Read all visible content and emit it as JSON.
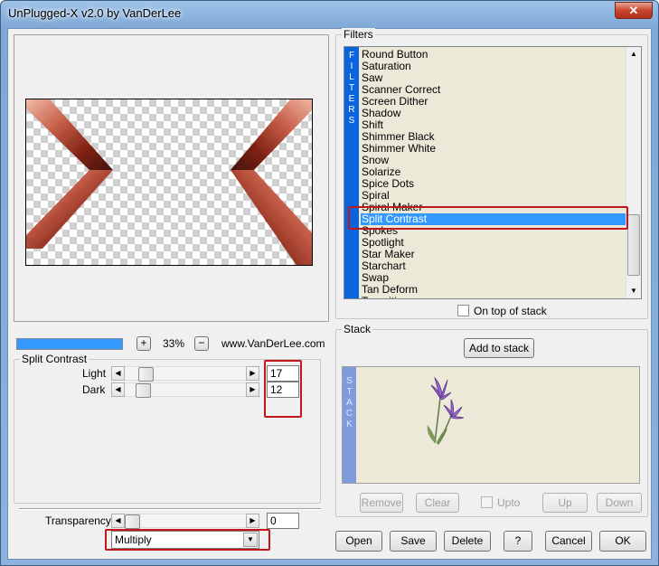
{
  "window": {
    "title": "UnPlugged-X v2.0 by VanDerLee",
    "close_glyph": "✕"
  },
  "preview": {
    "zoom_plus": "+",
    "zoom_value": "33%",
    "zoom_minus": "−",
    "website": "www.VanDerLee.com",
    "progress": 1.0
  },
  "filter_settings": {
    "group_label": "Split Contrast",
    "params": [
      {
        "label": "Light",
        "value": "17",
        "position": 0.13
      },
      {
        "label": "Dark",
        "value": "12",
        "position": 0.1
      }
    ],
    "transparency": {
      "label": "Transparency",
      "value": "0",
      "position": 0.0
    },
    "blend_mode": "Multiply"
  },
  "filters": {
    "group_label": "Filters",
    "strip_letters": [
      "F",
      "I",
      "L",
      "T",
      "E",
      "R",
      "S"
    ],
    "items": [
      "Round Button",
      "Saturation",
      "Saw",
      "Scanner Correct",
      "Screen Dither",
      "Shadow",
      "Shift",
      "Shimmer Black",
      "Shimmer White",
      "Snow",
      "Solarize",
      "Spice Dots",
      "Spiral",
      "Spiral Maker",
      "Split Contrast",
      "Spokes",
      "Spotlight",
      "Star Maker",
      "Starchart",
      "Swap",
      "Tan Deform",
      "Transition"
    ],
    "selected": "Split Contrast",
    "on_top_label": "On top of stack"
  },
  "stack": {
    "group_label": "Stack",
    "add_button": "Add to stack",
    "strip_letters": [
      "S",
      "T",
      "A",
      "C",
      "K"
    ],
    "remove_button": "Remove",
    "clear_button": "Clear",
    "upto_label": "Upto",
    "up_button": "Up",
    "down_button": "Down"
  },
  "bottom_buttons": {
    "open": "Open",
    "save": "Save",
    "delete": "Delete",
    "help": "?",
    "cancel": "Cancel",
    "ok": "OK"
  },
  "colors": {
    "selection": "#3399ff",
    "filters_strip": "#0a64e0",
    "stack_strip": "#7f9bdc",
    "highlight": "#c0161c",
    "progress_fill": "#3399ff"
  }
}
